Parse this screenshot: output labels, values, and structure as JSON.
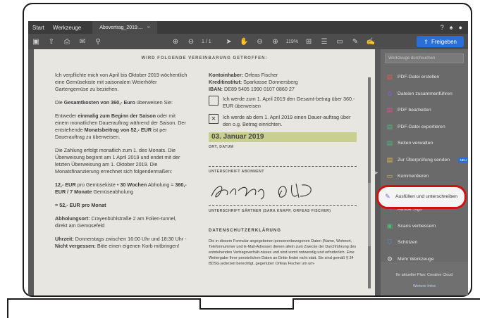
{
  "menubar": {
    "items": [
      "Start",
      "Werkzeuge"
    ],
    "doc_tab": "Abovertrag_2019....",
    "tab_close": "×"
  },
  "toolbar": {
    "page_indicator": "1 / 1",
    "zoom": "119%",
    "share_label": "Freigeben"
  },
  "document": {
    "heading": "WIRD FOLGENDE VEREINBARUNG GETROFFEN:",
    "left": {
      "p1": "Ich verpflichte mich von April bis Oktober 2019 wöchentlich eine Gemüsekiste mit saisonalem Weierhöfer Gartengemüse zu beziehen.",
      "p2_pre": "Die ",
      "p2_bold": "Gesamtkosten von 360,- Euro",
      "p2_post": " überweisen Sie:",
      "p3_pre": "Entweder ",
      "p3_bold1": "einmalig zum Beginn der Saison",
      "p3_mid": " oder mit einem monatlichen Dauerauftrag während der Saison. Der entstehende ",
      "p3_bold2": "Monatsbeitrag von 52,- EUR",
      "p3_post": " ist per Dauerauftrag zu überweisen.",
      "p4": "Die Zahlung erfolgt monatlich zum 1. des Monats. Die Überweisung beginnt am 1 April 2019 und endet mit der letzten Überweisung am 1. Oktober 2019. Die Monatsfinanzierung errechnet sich folgendermaßen:",
      "p5_bold1": "12,- EUR",
      "p5_mid1": " pro Gemüsekiste • ",
      "p5_bold2": "30 Wochen",
      "p5_mid2": " Abholung = ",
      "p5_bold3": "360,- EUR / 7 Monate",
      "p5_post": " Gemüseabholung",
      "p6_bold": "= 52,- EUR pro Monat",
      "p7_bold": "Abholungsort:",
      "p7_post": " Crayenbühlstraße 2 am Folien-tunnel, direkt am Gemüsefeld",
      "p8_bold": "Uhrzeit:",
      "p8_mid": " Donnerstags zwischen 16:00 Uhr und 18:30 Uhr - ",
      "p8_bold2": "Nicht vergessen:",
      "p8_post": " Bitte einen eigenen Korb mitbringen!"
    },
    "right": {
      "holder_label": "Kontoinhaber:",
      "holder": " Orfeas Fischer",
      "bank_label": "Kreditinstitut:",
      "bank": " Sparkasse Donnersberg",
      "iban_label": "IBAN:",
      "iban": " DE89 5405 1990 0107 0860 27",
      "option1": "Ich werde zum 1. April 2019 den Gesamt-betrag über 360.- EUR überweisen",
      "option2_mark": "×",
      "option2": "Ich werde ab dem 1. April 2019 einen Dauer-auftrag über den o.g. Betrag einrichten.",
      "date_value": "03. Januar 2019",
      "date_caption": "ORT, DATUM",
      "sig1_caption": "UNTERSCHRIFT ABONNENT",
      "sig2_caption": "UNTERSCHRIFT GÄRTNER (SARA KNAPP, ORFEAS FISCHER)",
      "privacy_heading": "DATENSCHUTZERKLÄRUNG",
      "privacy_text": "Die in diesem Formular angegebenen personenbezogenen Daten (Name, Wohnort, Telefonnummer und E-Mail-Adresse) dienen allein zum Zwecke der Durchführung des entstehenden Vertragsverhält-nisses und sind somit notwendig und erforderlich. Eine Weitergabe Ihrer persönlichen Daten an Dritte findet nicht statt. Sie sind gemäß § 34 BDSG jederzeit berechtigt, gegenüber Orfeas Fischer um um-"
    }
  },
  "tools": {
    "search_placeholder": "Werkzeuge durchsuchen",
    "items": [
      {
        "label": "PDF-Datei erstellen",
        "icon": "pdf-create-icon",
        "color": "#e05a4e"
      },
      {
        "label": "Dateien zusammenführen",
        "icon": "combine-icon",
        "color": "#8a5cd6"
      },
      {
        "label": "PDF bearbeiten",
        "icon": "edit-pdf-icon",
        "color": "#e0508a"
      },
      {
        "label": "PDF-Datei exportieren",
        "icon": "export-icon",
        "color": "#4fb87a"
      },
      {
        "label": "Seiten verwalten",
        "icon": "pages-icon",
        "color": "#4fb87a"
      },
      {
        "label": "Zur Überprüfung senden",
        "icon": "review-icon",
        "color": "#e0b84e"
      },
      {
        "label": "Kommentieren",
        "icon": "comment-icon",
        "color": "#e0b84e"
      },
      {
        "label": "Ausfüllen und unterschreiben",
        "icon": "fill-sign-icon",
        "color": "#8a5cd6"
      },
      {
        "label": "Adobe Sign",
        "icon": "adobe-sign-icon",
        "color": "#8a5cd6"
      },
      {
        "label": "Scans verbessern",
        "icon": "scan-icon",
        "color": "#4fb87a"
      },
      {
        "label": "Schützen",
        "icon": "protect-icon",
        "color": "#5b8de0"
      },
      {
        "label": "Mehr Werkzeuge",
        "icon": "more-tools-icon",
        "color": "#dddddd"
      }
    ],
    "new_badge": "NEU",
    "footer_text": "Ihr aktueller Plan: Creative Cloud",
    "footer_link": "Weitere Infos"
  }
}
